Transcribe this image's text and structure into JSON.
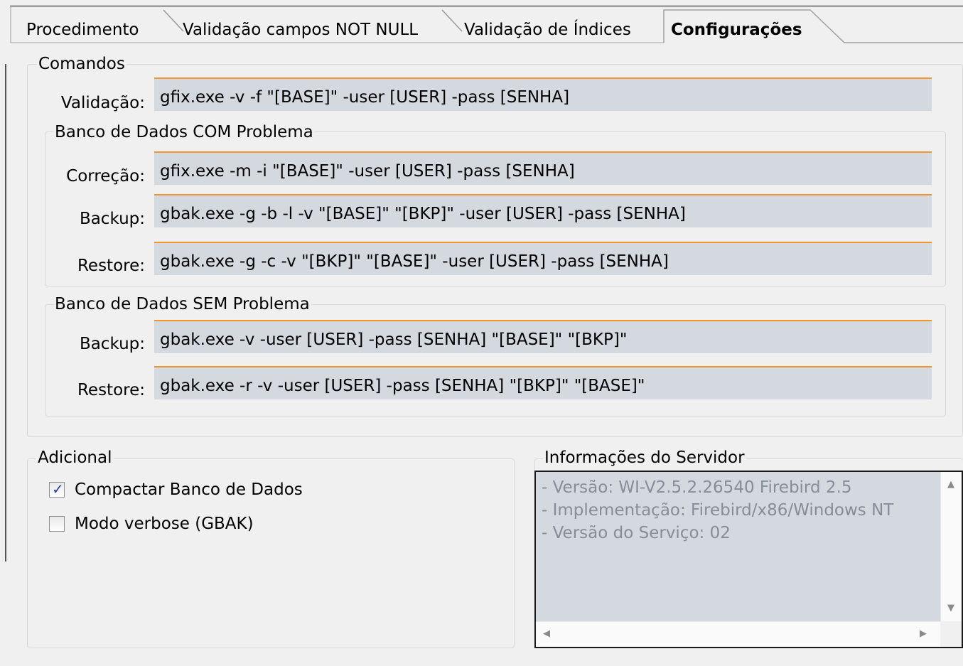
{
  "tabs": [
    {
      "label": "Procedimento",
      "active": false
    },
    {
      "label": "Validação campos NOT NULL",
      "active": false
    },
    {
      "label": "Validação de Índices",
      "active": false
    },
    {
      "label": "Configurações",
      "active": true
    }
  ],
  "comandos": {
    "title": "Comandos",
    "validacao_label": "Validação:",
    "validacao_value": "gfix.exe -v -f \"[BASE]\" -user [USER] -pass [SENHA]",
    "com_problema": {
      "title": "Banco de Dados COM Problema",
      "correcao_label": "Correção:",
      "correcao_value": "gfix.exe -m -i \"[BASE]\" -user [USER] -pass [SENHA]",
      "backup_label": "Backup:",
      "backup_value": "gbak.exe -g -b -l -v \"[BASE]\" \"[BKP]\" -user [USER] -pass [SENHA]",
      "restore_label": "Restore:",
      "restore_value": "gbak.exe -g -c -v \"[BKP]\" \"[BASE]\" -user [USER] -pass [SENHA]"
    },
    "sem_problema": {
      "title": "Banco de Dados SEM Problema",
      "backup_label": "Backup:",
      "backup_value": "gbak.exe -v -user [USER] -pass [SENHA] \"[BASE]\" \"[BKP]\"",
      "restore_label": "Restore:",
      "restore_value": "gbak.exe -r -v -user [USER] -pass [SENHA] \"[BKP]\" \"[BASE]\""
    }
  },
  "adicional": {
    "title": "Adicional",
    "options": [
      {
        "label": "Compactar Banco de Dados",
        "checked": true
      },
      {
        "label": "Modo verbose (GBAK)",
        "checked": false
      }
    ]
  },
  "servidor": {
    "title": "Informações do Servidor",
    "lines": [
      "- Versão: WI-V2.5.2.26540 Firebird 2.5",
      "- Implementação: Firebird/x86/Windows NT",
      "- Versão do Serviço: 02"
    ]
  },
  "icons": {
    "scroll_up": "scroll-up-arrow-icon",
    "scroll_down": "scroll-down-arrow-icon",
    "scroll_left": "scroll-left-arrow-icon",
    "scroll_right": "scroll-right-arrow-icon",
    "check": "checkmark-icon"
  },
  "colors": {
    "field_background": "#d4d9df",
    "field_accent": "#f0962d",
    "panel_background": "#f0f0f0",
    "memo_text": "#868d95"
  }
}
